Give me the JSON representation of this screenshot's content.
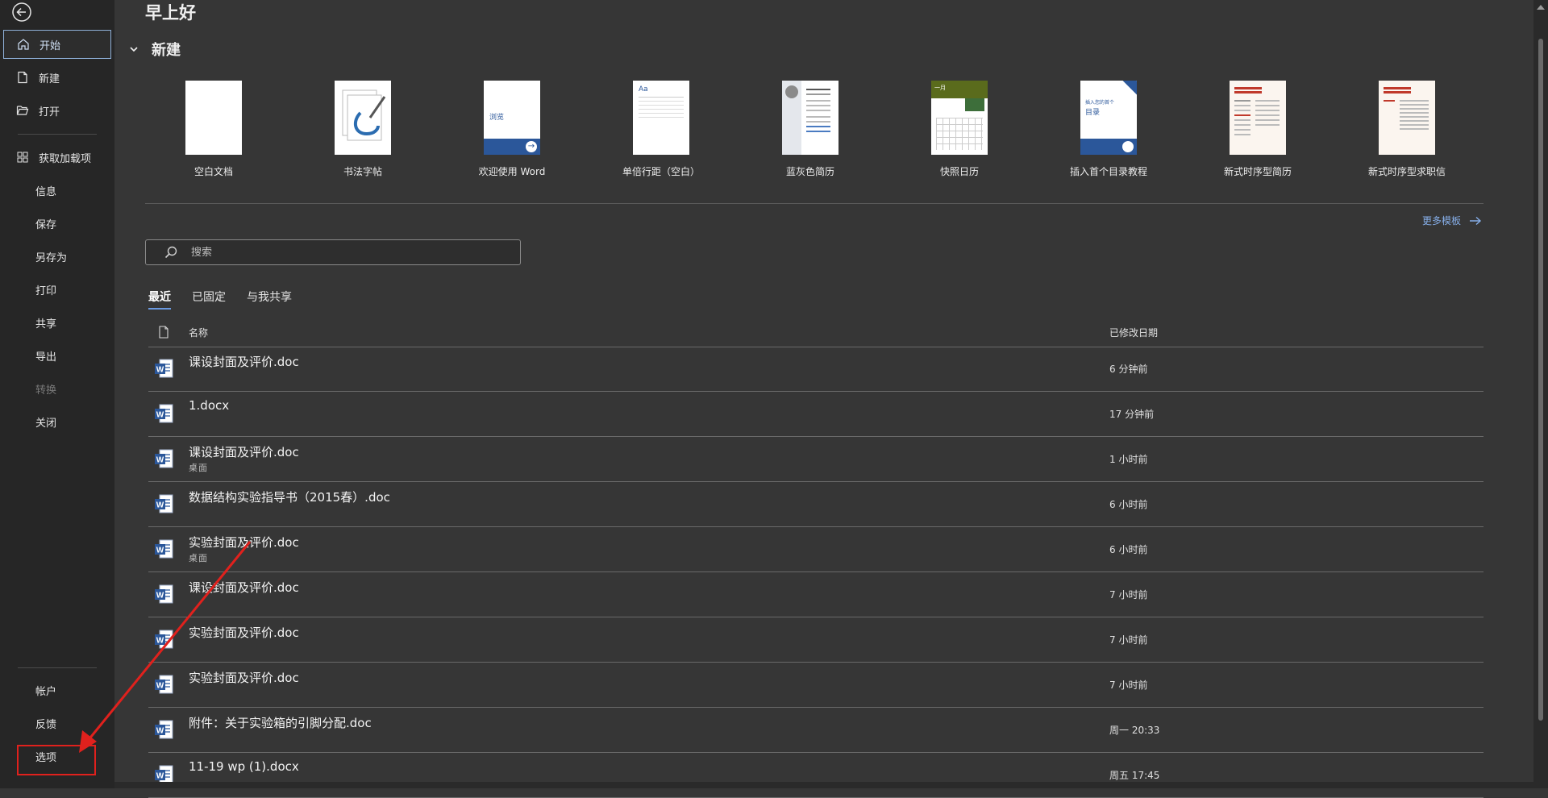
{
  "sidebar": {
    "items": [
      {
        "label": "开始",
        "icon": "home-icon",
        "active": true
      },
      {
        "label": "新建",
        "icon": "new-document-icon"
      },
      {
        "label": "打开",
        "icon": "open-folder-icon"
      },
      {
        "label": "获取加载项",
        "icon": "addins-grid-icon"
      },
      {
        "label": "信息"
      },
      {
        "label": "保存"
      },
      {
        "label": "另存为"
      },
      {
        "label": "打印"
      },
      {
        "label": "共享"
      },
      {
        "label": "导出"
      },
      {
        "label": "转换",
        "disabled": true
      },
      {
        "label": "关闭"
      }
    ],
    "bottom_items": [
      {
        "label": "帐户"
      },
      {
        "label": "反馈"
      },
      {
        "label": "选项"
      }
    ]
  },
  "main": {
    "greeting": "早上好",
    "new_section_title": "新建",
    "templates": [
      {
        "label": "空白文档"
      },
      {
        "label": "书法字帖"
      },
      {
        "label": "欢迎使用 Word",
        "thumb_text": "浏览"
      },
      {
        "label": "单倍行距（空白）",
        "thumb_text": "Aa"
      },
      {
        "label": "蓝灰色简历"
      },
      {
        "label": "快照日历",
        "thumb_text": "一月"
      },
      {
        "label": "插入首个目录教程",
        "thumb_text": "插入您的首个",
        "thumb_text2": "目录"
      },
      {
        "label": "新式时序型简历"
      },
      {
        "label": "新式时序型求职信"
      }
    ],
    "more_templates": "更多模板",
    "search_placeholder": "搜索",
    "tabs": [
      "最近",
      "已固定",
      "与我共享"
    ],
    "list_header": {
      "name": "名称",
      "date": "已修改日期"
    },
    "files": [
      {
        "name": "课设封面及评价.doc",
        "path": "",
        "date": "6 分钟前"
      },
      {
        "name": "1.docx",
        "path": "",
        "date": "17 分钟前"
      },
      {
        "name": "课设封面及评价.doc",
        "path": "桌面",
        "date": "1 小时前"
      },
      {
        "name": "数据结构实验指导书（2015春）.doc",
        "path": "",
        "date": "6 小时前"
      },
      {
        "name": "实验封面及评价.doc",
        "path": "桌面",
        "date": "6 小时前"
      },
      {
        "name": "课设封面及评价.doc",
        "path": "",
        "date": "7 小时前"
      },
      {
        "name": "实验封面及评价.doc",
        "path": "",
        "date": "7 小时前"
      },
      {
        "name": "实验封面及评价.doc",
        "path": "",
        "date": "7 小时前"
      },
      {
        "name": "附件：关于实验箱的引脚分配.doc",
        "path": "",
        "date": "周一 20:33"
      },
      {
        "name": "11-19 wp (1).docx",
        "path": "",
        "date": "周五 17:45"
      }
    ]
  },
  "colors": {
    "accent": "#86aee8",
    "annotation_red": "#e0211d",
    "word_blue": "#2b579a"
  }
}
